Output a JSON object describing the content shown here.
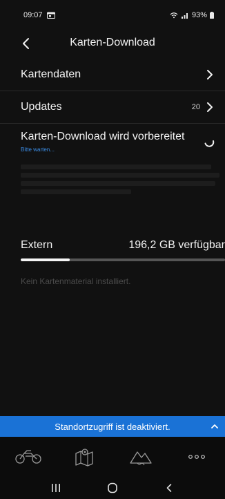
{
  "status_bar": {
    "time": "09:07",
    "battery": "93%"
  },
  "header": {
    "title": "Karten-Download"
  },
  "menu": {
    "kartendaten_label": "Kartendaten",
    "updates_label": "Updates",
    "updates_count": "20"
  },
  "download": {
    "title": "Karten-Download wird vorbereitet",
    "subtitle": "Bitte warten..."
  },
  "storage": {
    "label": "Extern",
    "free": "196,2 GB verfügbar",
    "used_fraction": 0.24
  },
  "empty_state": {
    "text": "Kein Kartenmaterial installiert."
  },
  "location_banner": {
    "text": "Standortzugriff ist deaktiviert."
  },
  "bottom_nav": {
    "items": [
      "motorcycle-icon",
      "map-icon",
      "mountain-icon",
      "more-icon"
    ]
  },
  "colors": {
    "background": "#111111",
    "accent_blue": "#1a72d6",
    "link_blue": "#3b8ee8"
  }
}
